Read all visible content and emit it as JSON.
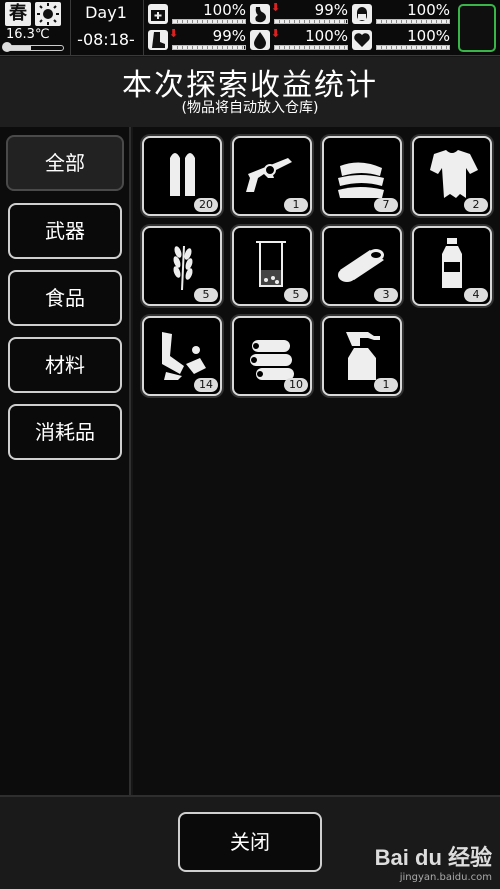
{
  "status": {
    "season": "春",
    "temperature": "16.3℃",
    "temperature_level": 0.45,
    "day": "Day1",
    "time": "-08:18-",
    "stats": [
      {
        "icon": "medkit-icon",
        "value": "100%",
        "level": 1.0,
        "trend_down": false
      },
      {
        "icon": "stomach-icon",
        "value": "99%",
        "level": 0.99,
        "trend_down": true
      },
      {
        "icon": "capsule-icon",
        "value": "100%",
        "level": 1.0,
        "trend_down": false
      },
      {
        "icon": "boot-icon",
        "value": "99%",
        "level": 0.99,
        "trend_down": true
      },
      {
        "icon": "water-drop-icon",
        "value": "100%",
        "level": 1.0,
        "trend_down": true
      },
      {
        "icon": "heart-icon",
        "value": "100%",
        "level": 1.0,
        "trend_down": false
      }
    ],
    "accent_color": "#39b54a"
  },
  "header": {
    "title": "本次探索收益统计",
    "subtitle": "(物品将自动放入仓库)"
  },
  "sidebar": {
    "categories": [
      {
        "label": "全部",
        "active": true
      },
      {
        "label": "武器",
        "active": false
      },
      {
        "label": "食品",
        "active": false
      },
      {
        "label": "材料",
        "active": false
      },
      {
        "label": "消耗品",
        "active": false
      }
    ]
  },
  "items": [
    {
      "icon": "bullets-icon",
      "count": "20"
    },
    {
      "icon": "revolver-icon",
      "count": "1"
    },
    {
      "icon": "cloth-pile-icon",
      "count": "7"
    },
    {
      "icon": "torn-shirt-icon",
      "count": "2"
    },
    {
      "icon": "wheat-icon",
      "count": "5"
    },
    {
      "icon": "beaker-icon",
      "count": "5"
    },
    {
      "icon": "canned-food-icon",
      "count": "3"
    },
    {
      "icon": "water-bottle-icon",
      "count": "4"
    },
    {
      "icon": "scrap-parts-icon",
      "count": "14"
    },
    {
      "icon": "wood-logs-icon",
      "count": "10"
    },
    {
      "icon": "spray-bottle-icon",
      "count": "1"
    }
  ],
  "footer": {
    "close_label": "关闭"
  },
  "watermark": {
    "brand": "Bai du 经验",
    "url": "jingyan.baidu.com"
  }
}
